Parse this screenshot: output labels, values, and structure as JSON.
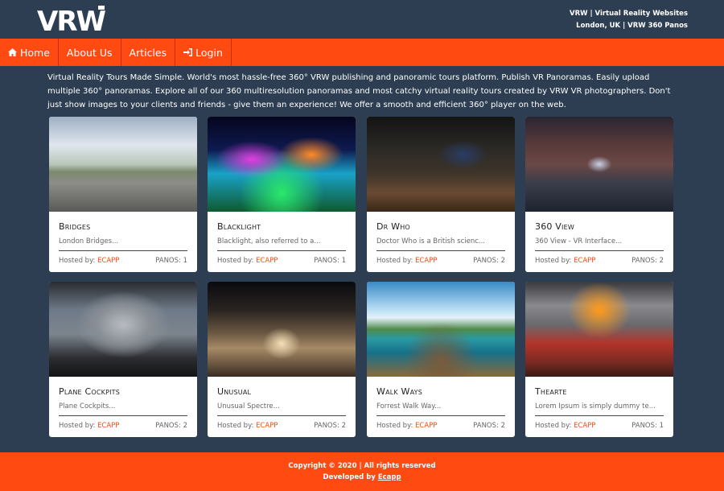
{
  "header": {
    "logo_text": "VRW",
    "info_line1": "VRW | Virtual Reality Websites",
    "info_line2": "London, UK | VRW 360 Panos"
  },
  "nav": {
    "items": [
      {
        "label": "Home",
        "icon": "home-icon"
      },
      {
        "label": "About Us"
      },
      {
        "label": "Articles"
      },
      {
        "label": "Login",
        "icon": "sign-in-icon"
      }
    ]
  },
  "intro": "Virtual Reality Tours Made Simple. World's most hassle-free 360° VRW publishing and panoramic tours platform. Publish VR Panoramas. Easily upload multiple 360° panoramas. Explore all of our 360 multiresolution panoramas and most catchy virtual reality tours created by VRW VR photographers. Don't just show images to your clients and friends - give them an experience! We offer a smooth and efficient 360° player on the web.",
  "cards": [
    {
      "title": "Bridges",
      "desc": "London Bridges...",
      "host_label": "Hosted by:",
      "host": "ECAPP",
      "panos": "PANOS: 1"
    },
    {
      "title": "Blacklight",
      "desc": "Blacklight, also referred to a...",
      "host_label": "Hosted by:",
      "host": "ECAPP",
      "panos": "PANOS: 1"
    },
    {
      "title": "Dr Who",
      "desc": "Doctor Who is a British scienc...",
      "host_label": "Hosted by:",
      "host": "ECAPP",
      "panos": "PANOS: 2"
    },
    {
      "title": "360 View",
      "desc": "360 View - VR Interface...",
      "host_label": "Hosted by:",
      "host": "ECAPP",
      "panos": "PANOS: 2"
    },
    {
      "title": "Plane Cockpits",
      "desc": "Plane Cockpits...",
      "host_label": "Hosted by:",
      "host": "ECAPP",
      "panos": "PANOS: 2"
    },
    {
      "title": "Unusual",
      "desc": "Unusual Spectre...",
      "host_label": "Hosted by:",
      "host": "ECAPP",
      "panos": "PANOS: 2"
    },
    {
      "title": "Walk Ways",
      "desc": "Forrest Walk Way...",
      "host_label": "Hosted by:",
      "host": "ECAPP",
      "panos": "PANOS: 2"
    },
    {
      "title": "Thearte",
      "desc": "Lorem Ipsum is simply dummy te...",
      "host_label": "Hosted by:",
      "host": "ECAPP",
      "panos": "PANOS: 1"
    }
  ],
  "footer": {
    "copyright": "Copyright © 2020 | All rights reserved",
    "developed_by": "Developed by",
    "developer": "Ecapp"
  },
  "colors": {
    "accent": "#ff4a12",
    "background": "#2d3e52"
  }
}
